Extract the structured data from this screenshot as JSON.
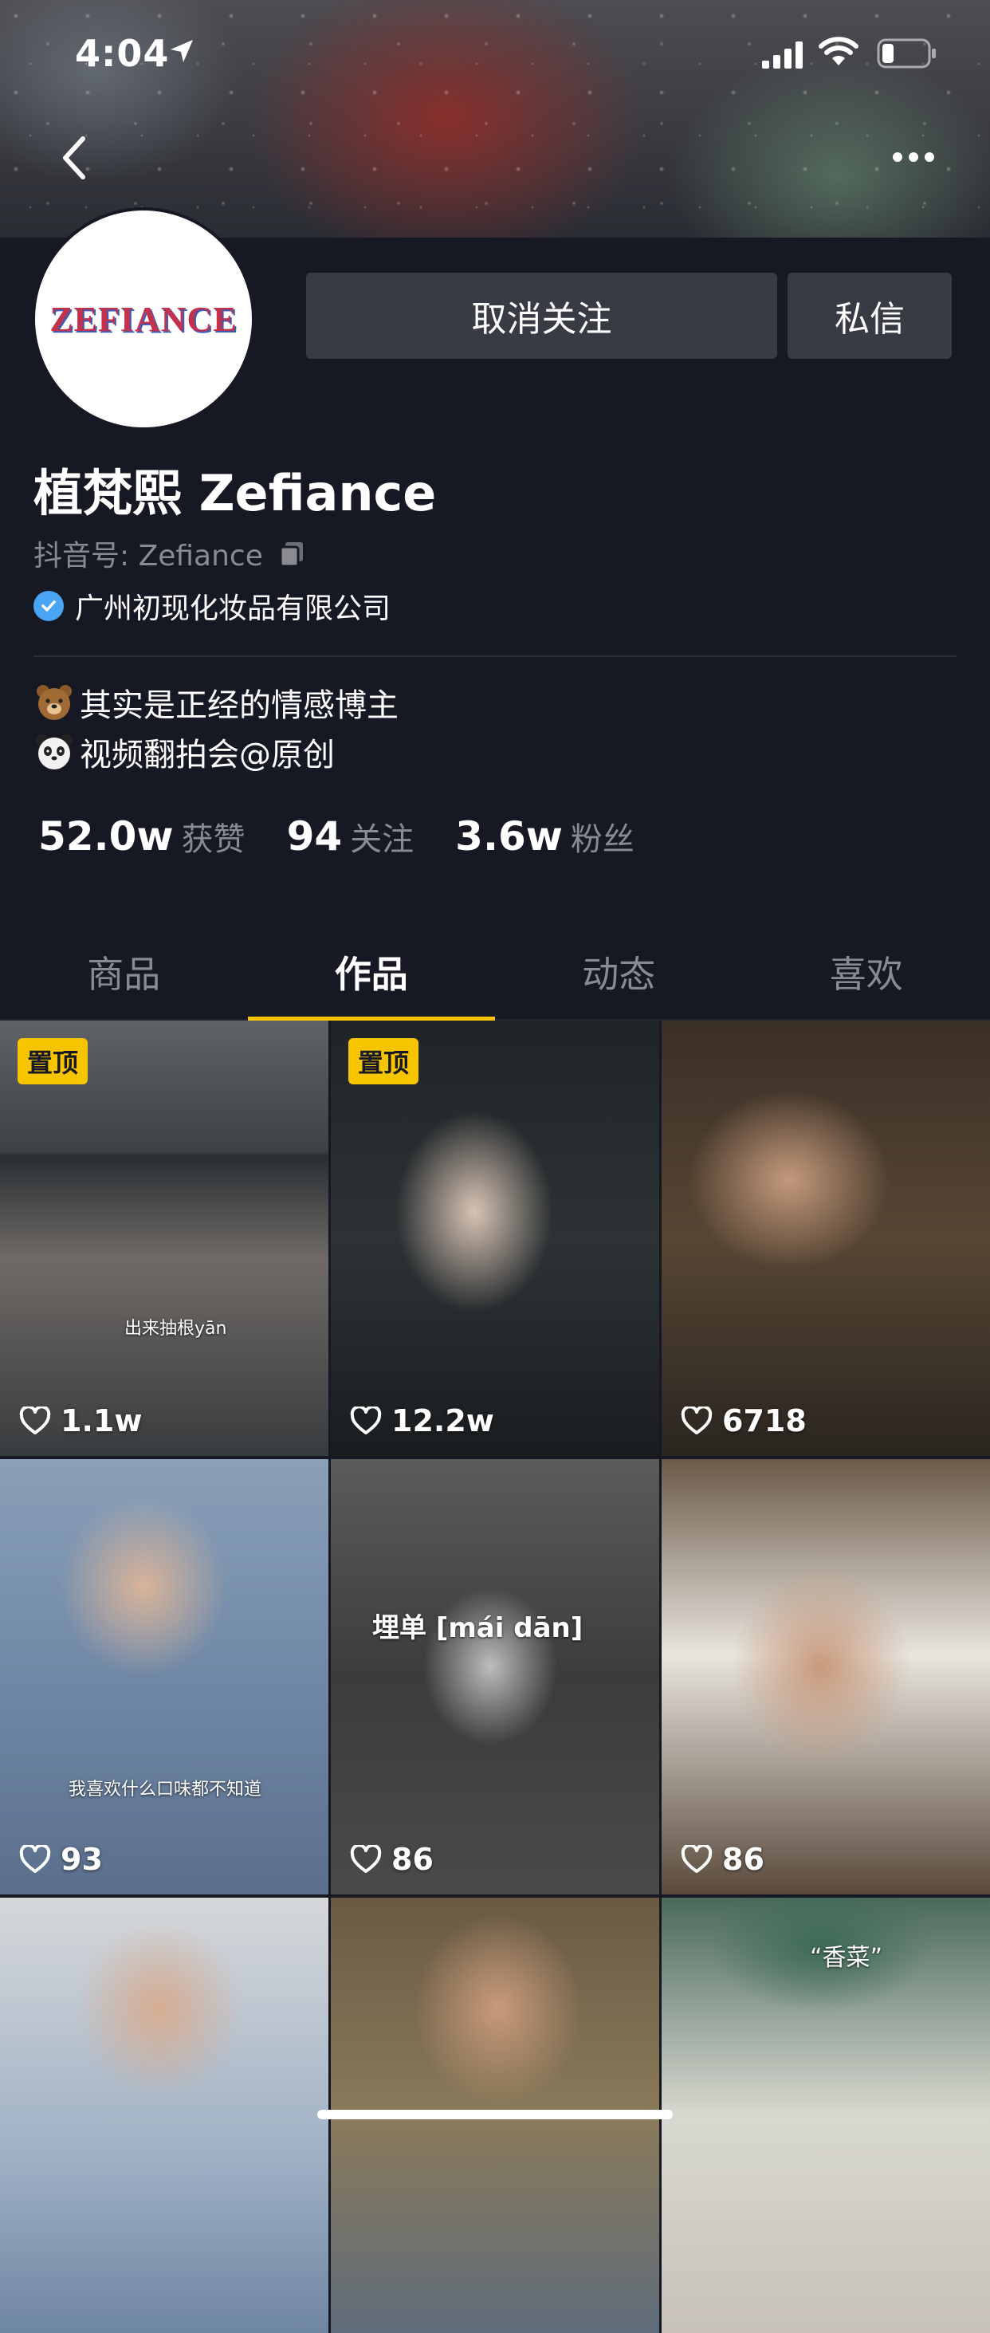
{
  "status_bar": {
    "time": "4:04"
  },
  "profile": {
    "avatar_logo_text": "ZEFIANCE",
    "unfollow_label": "取消关注",
    "message_label": "私信",
    "display_name": "植梵熙 Zefiance",
    "douyin_id": "抖音号: Zefiance",
    "verified_company": "广州初现化妆品有限公司",
    "bio": [
      {
        "icon": "bear-emoji-icon",
        "text": "其实是正经的情感博主"
      },
      {
        "icon": "panda-emoji-icon",
        "text": "视频翻拍会@原创"
      }
    ],
    "stats": [
      {
        "value": "52.0w",
        "label": "获赞"
      },
      {
        "value": "94",
        "label": "关注"
      },
      {
        "value": "3.6w",
        "label": "粉丝"
      }
    ]
  },
  "tabs": [
    {
      "label": "商品",
      "active": false
    },
    {
      "label": "作品",
      "active": true
    },
    {
      "label": "动态",
      "active": false
    },
    {
      "label": "喜欢",
      "active": false
    }
  ],
  "videos": [
    {
      "pinned": true,
      "pin_label": "置顶",
      "likes": "1.1w",
      "caption": "出来抽根yān"
    },
    {
      "pinned": true,
      "pin_label": "置顶",
      "likes": "12.2w",
      "caption": ""
    },
    {
      "pinned": false,
      "likes": "6718",
      "caption": ""
    },
    {
      "pinned": false,
      "likes": "93",
      "caption": "我喜欢什么口味都不知道"
    },
    {
      "pinned": false,
      "likes": "86",
      "caption": "埋单 [mái dān]"
    },
    {
      "pinned": false,
      "likes": "86",
      "caption": ""
    },
    {
      "pinned": false,
      "likes": "",
      "caption": ""
    },
    {
      "pinned": false,
      "likes": "",
      "caption": ""
    },
    {
      "pinned": false,
      "likes": "",
      "caption": "“香菜”"
    }
  ],
  "colors": {
    "background": "#161823",
    "accent_yellow": "#f7c400",
    "button_bg": "#393b44",
    "verified_blue": "#4aa6f5",
    "muted_text": "#8a8b91"
  }
}
